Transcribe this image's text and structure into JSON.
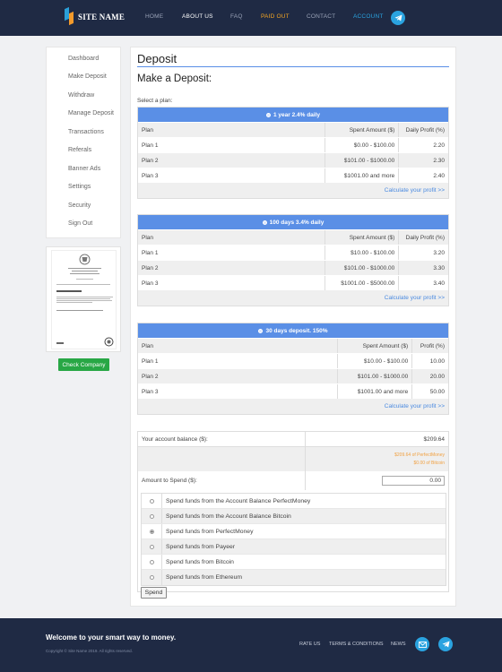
{
  "header": {
    "logo_text": "SITE NAME",
    "nav": [
      {
        "label": "HOME",
        "color": "#9aa3b8"
      },
      {
        "label": "ABOUT US",
        "color": "#ffffff"
      },
      {
        "label": "FAQ",
        "color": "#9aa3b8"
      },
      {
        "label": "PAID OUT",
        "color": "#f5a623"
      },
      {
        "label": "CONTACT",
        "color": "#9aa3b8"
      },
      {
        "label": "ACCOUNT",
        "color": "#2aa3e0"
      }
    ],
    "telegram_icon": "telegram-icon"
  },
  "sidebar": {
    "items": [
      "Dashboard",
      "Make Deposit",
      "Withdraw",
      "Manage Deposit",
      "Transactions",
      "Referals",
      "Banner Ads",
      "Settings",
      "Security",
      "Sign Out"
    ],
    "check_company": "Check Company"
  },
  "main": {
    "page_title": "Deposit",
    "section_title": "Make a Deposit:",
    "select_label": "Select a plan:",
    "calc_label": "Calculate your profit >>",
    "plans": [
      {
        "title": "1 year 2.4% daily",
        "headers": [
          "Plan",
          "Spent Amount ($)",
          "Daily Profit (%)"
        ],
        "rows": [
          [
            "Plan 1",
            "$0.00 - $100.00",
            "2.20"
          ],
          [
            "Plan 2",
            "$101.00 - $1000.00",
            "2.30"
          ],
          [
            "Plan 3",
            "$1001.00 and more",
            "2.40"
          ]
        ]
      },
      {
        "title": "100 days 3.4% daily",
        "headers": [
          "Plan",
          "Spent Amount ($)",
          "Daily Profit (%)"
        ],
        "rows": [
          [
            "Plan 1",
            "$10.00 - $100.00",
            "3.20"
          ],
          [
            "Plan 2",
            "$101.00 - $1000.00",
            "3.30"
          ],
          [
            "Plan 3",
            "$1001.00 - $5000.00",
            "3.40"
          ]
        ]
      },
      {
        "title": "30 days deposit. 150%",
        "headers": [
          "Plan",
          "Spent Amount ($)",
          "Profit (%)"
        ],
        "rows": [
          [
            "Plan 1",
            "$10.00 - $100.00",
            "10.00"
          ],
          [
            "Plan 2",
            "$101.00 - $1000.00",
            "20.00"
          ],
          [
            "Plan 3",
            "$1001.00 and more",
            "50.00"
          ]
        ]
      }
    ],
    "balance": {
      "label": "Your account balance ($):",
      "value": "$209.64",
      "sub_pm": "$209.64 of PerfectMoney",
      "sub_btc": "$0.00 of Bitcoin",
      "amount_label": "Amount to Spend ($):",
      "amount_value": "0.00"
    },
    "options": [
      {
        "label": "Spend funds from the Account Balance PerfectMoney",
        "checked": false
      },
      {
        "label": "Spend funds from the Account Balance Bitcoin",
        "checked": false
      },
      {
        "label": "Spend funds from PerfectMoney",
        "checked": true
      },
      {
        "label": "Spend funds from Payeer",
        "checked": false
      },
      {
        "label": "Spend funds from Bitcoin",
        "checked": false
      },
      {
        "label": "Spend funds from Ethereum",
        "checked": false
      }
    ],
    "spend_button": "Spend"
  },
  "footer": {
    "title": "Welcome to your smart way to money.",
    "copyright": "Copyright © Site Name 2019. All rights reserved.",
    "links": [
      "RATE US",
      "TERMS & CONDITIONS",
      "NEWS"
    ],
    "icons": [
      "mail-icon",
      "telegram-icon"
    ]
  }
}
